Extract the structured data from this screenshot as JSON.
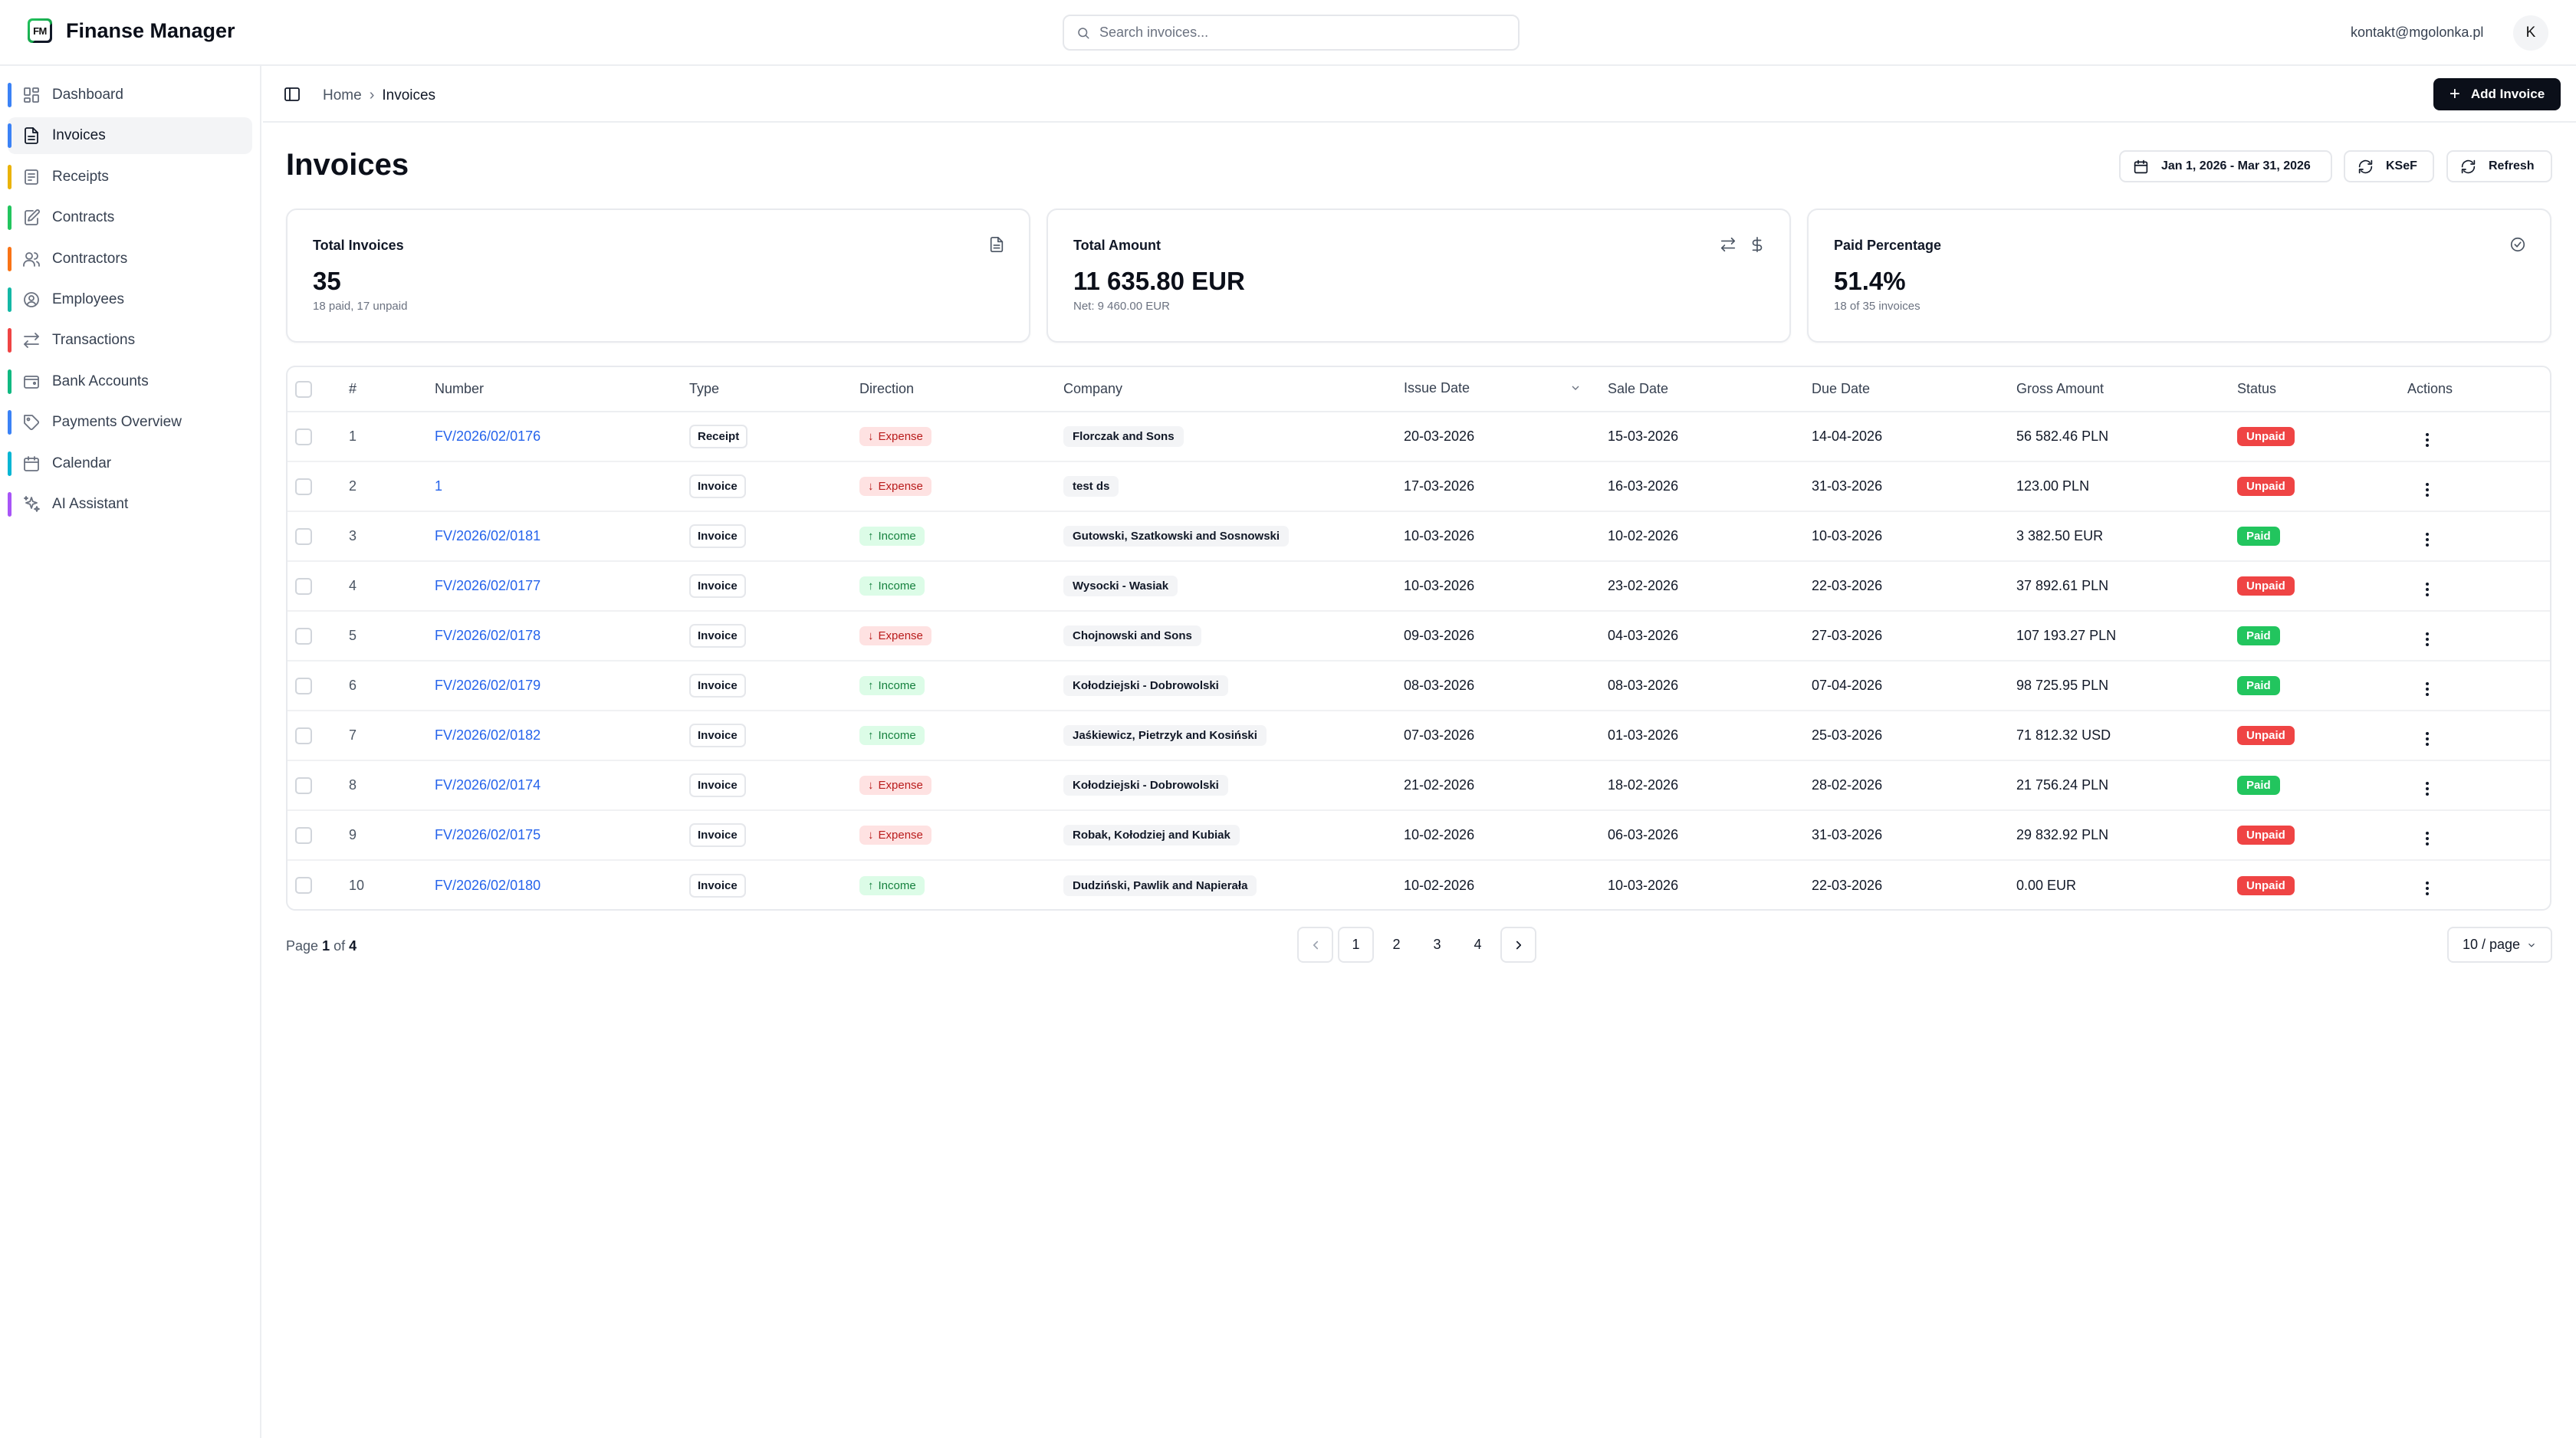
{
  "app": {
    "logo_text": "FM",
    "name": "Finanse Manager"
  },
  "search": {
    "placeholder": "Search invoices..."
  },
  "user": {
    "email": "kontakt@mgolonka.pl",
    "avatar_initial": "K"
  },
  "sidebar": {
    "items": [
      {
        "label": "Dashboard",
        "icon": "dashboard-icon",
        "color": "#3b82f6",
        "active": false
      },
      {
        "label": "Invoices",
        "icon": "file-text-icon",
        "color": "#3b82f6",
        "active": true
      },
      {
        "label": "Receipts",
        "icon": "receipt-icon",
        "color": "#eab308",
        "active": false
      },
      {
        "label": "Contracts",
        "icon": "contract-icon",
        "color": "#22c55e",
        "active": false
      },
      {
        "label": "Contractors",
        "icon": "users-icon",
        "color": "#f97316",
        "active": false
      },
      {
        "label": "Employees",
        "icon": "user-circle-icon",
        "color": "#14b8a6",
        "active": false
      },
      {
        "label": "Transactions",
        "icon": "arrows-icon",
        "color": "#ef4444",
        "active": false
      },
      {
        "label": "Bank Accounts",
        "icon": "wallet-icon",
        "color": "#10b981",
        "active": false
      },
      {
        "label": "Payments Overview",
        "icon": "tag-icon",
        "color": "#3b82f6",
        "active": false
      },
      {
        "label": "Calendar",
        "icon": "calendar-icon",
        "color": "#06b6d4",
        "active": false
      },
      {
        "label": "AI Assistant",
        "icon": "sparkles-icon",
        "color": "#a855f7",
        "active": false
      }
    ]
  },
  "breadcrumb": {
    "home": "Home",
    "current": "Invoices"
  },
  "toolbar": {
    "add_label": "Add Invoice"
  },
  "page": {
    "title": "Invoices",
    "date_range": "Jan 1, 2026 - Mar 31, 2026",
    "ksef_label": "KSeF",
    "refresh_label": "Refresh"
  },
  "stats": {
    "total_invoices": {
      "label": "Total Invoices",
      "value": "35",
      "sub": "18 paid, 17 unpaid"
    },
    "total_amount": {
      "label": "Total Amount",
      "value": "11 635.80 EUR",
      "sub": "Net: 9 460.00 EUR"
    },
    "paid_percentage": {
      "label": "Paid Percentage",
      "value": "51.4%",
      "sub": "18 of 35 invoices"
    }
  },
  "table": {
    "headers": {
      "index": "#",
      "number": "Number",
      "type": "Type",
      "direction": "Direction",
      "company": "Company",
      "issue_date": "Issue Date",
      "sale_date": "Sale Date",
      "due_date": "Due Date",
      "gross_amount": "Gross Amount",
      "status": "Status",
      "actions": "Actions"
    },
    "rows": [
      {
        "idx": "1",
        "number": "FV/2026/02/0176",
        "type": "Receipt",
        "direction": "Expense",
        "company": "Florczak and Sons",
        "issue": "20-03-2026",
        "sale": "15-03-2026",
        "due": "14-04-2026",
        "gross": "56 582.46 PLN",
        "status": "Unpaid"
      },
      {
        "idx": "2",
        "number": "1",
        "type": "Invoice",
        "direction": "Expense",
        "company": "test ds",
        "issue": "17-03-2026",
        "sale": "16-03-2026",
        "due": "31-03-2026",
        "gross": "123.00 PLN",
        "status": "Unpaid"
      },
      {
        "idx": "3",
        "number": "FV/2026/02/0181",
        "type": "Invoice",
        "direction": "Income",
        "company": "Gutowski, Szatkowski and Sosnowski",
        "issue": "10-03-2026",
        "sale": "10-02-2026",
        "due": "10-03-2026",
        "gross": "3 382.50 EUR",
        "status": "Paid"
      },
      {
        "idx": "4",
        "number": "FV/2026/02/0177",
        "type": "Invoice",
        "direction": "Income",
        "company": "Wysocki - Wasiak",
        "issue": "10-03-2026",
        "sale": "23-02-2026",
        "due": "22-03-2026",
        "gross": "37 892.61 PLN",
        "status": "Unpaid"
      },
      {
        "idx": "5",
        "number": "FV/2026/02/0178",
        "type": "Invoice",
        "direction": "Expense",
        "company": "Chojnowski and Sons",
        "issue": "09-03-2026",
        "sale": "04-03-2026",
        "due": "27-03-2026",
        "gross": "107 193.27 PLN",
        "status": "Paid"
      },
      {
        "idx": "6",
        "number": "FV/2026/02/0179",
        "type": "Invoice",
        "direction": "Income",
        "company": "Kołodziejski - Dobrowolski",
        "issue": "08-03-2026",
        "sale": "08-03-2026",
        "due": "07-04-2026",
        "gross": "98 725.95 PLN",
        "status": "Paid"
      },
      {
        "idx": "7",
        "number": "FV/2026/02/0182",
        "type": "Invoice",
        "direction": "Income",
        "company": "Jaśkiewicz, Pietrzyk and Kosiński",
        "issue": "07-03-2026",
        "sale": "01-03-2026",
        "due": "25-03-2026",
        "gross": "71 812.32 USD",
        "status": "Unpaid"
      },
      {
        "idx": "8",
        "number": "FV/2026/02/0174",
        "type": "Invoice",
        "direction": "Expense",
        "company": "Kołodziejski - Dobrowolski",
        "issue": "21-02-2026",
        "sale": "18-02-2026",
        "due": "28-02-2026",
        "gross": "21 756.24 PLN",
        "status": "Paid"
      },
      {
        "idx": "9",
        "number": "FV/2026/02/0175",
        "type": "Invoice",
        "direction": "Expense",
        "company": "Robak, Kołodziej and Kubiak",
        "issue": "10-02-2026",
        "sale": "06-03-2026",
        "due": "31-03-2026",
        "gross": "29 832.92 PLN",
        "status": "Unpaid"
      },
      {
        "idx": "10",
        "number": "FV/2026/02/0180",
        "type": "Invoice",
        "direction": "Income",
        "company": "Dudziński, Pawlik and Napierała",
        "issue": "10-02-2026",
        "sale": "10-03-2026",
        "due": "22-03-2026",
        "gross": "0.00 EUR",
        "status": "Unpaid"
      }
    ]
  },
  "pagination": {
    "page_word": "Page",
    "current": "1",
    "of_word": "of",
    "total": "4",
    "pages": [
      "1",
      "2",
      "3",
      "4"
    ],
    "per_page": "10 / page"
  }
}
